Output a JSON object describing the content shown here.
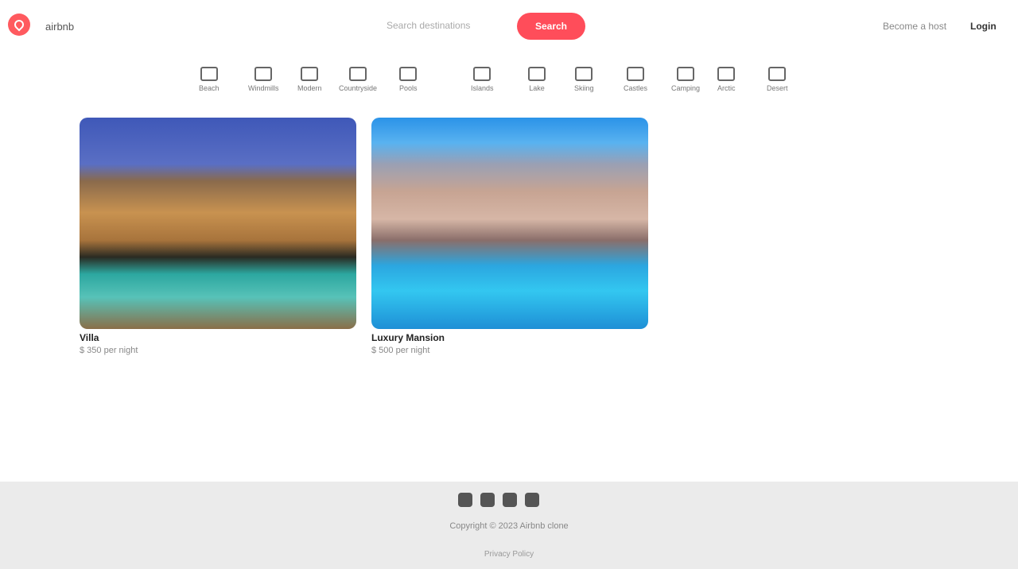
{
  "header": {
    "brand": "airbnb",
    "search_placeholder": "Search destinations",
    "search_button": "Search",
    "host_link": "Become a host",
    "login_link": "Login"
  },
  "categories": [
    {
      "label": "Beach",
      "icon": "beach-icon"
    },
    {
      "label": "Windmills",
      "icon": "windmill-icon"
    },
    {
      "label": "Modern",
      "icon": "modern-icon"
    },
    {
      "label": "Countryside",
      "icon": "countryside-icon"
    },
    {
      "label": "Pools",
      "icon": "pool-icon"
    },
    {
      "label": "Islands",
      "icon": "island-icon"
    },
    {
      "label": "Lake",
      "icon": "lake-icon"
    },
    {
      "label": "Skiing",
      "icon": "skiing-icon"
    },
    {
      "label": "Castles",
      "icon": "castle-icon"
    },
    {
      "label": "Camping",
      "icon": "camping-icon"
    },
    {
      "label": "Arctic",
      "icon": "arctic-icon"
    },
    {
      "label": "Desert",
      "icon": "desert-icon"
    }
  ],
  "listings": [
    {
      "title": "Villa",
      "subtitle": "$ 350 per night"
    },
    {
      "title": "Luxury Mansion",
      "subtitle": "$ 500 per night"
    }
  ],
  "footer": {
    "text": "Copyright © 2023 Airbnb clone",
    "sub": "Privacy Policy"
  },
  "colors": {
    "accent": "#ff5a5f",
    "search_button": "#ff4d5a",
    "footer_bg": "#ebebeb"
  }
}
